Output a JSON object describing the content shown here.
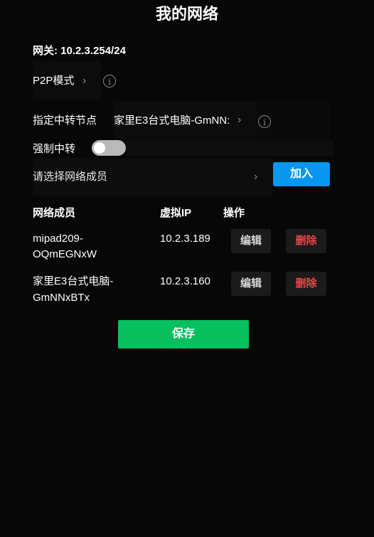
{
  "page": {
    "title": "我的网络"
  },
  "gateway": {
    "text": "网关: 10.2.3.254/24"
  },
  "p2p": {
    "label": "P2P模式",
    "chevron": "›",
    "info_icon": "i"
  },
  "relay": {
    "label": "指定中转节点",
    "value": "家里E3台式电脑-GmNN:",
    "chevron": "›",
    "info_icon": "i"
  },
  "force_relay": {
    "label": "强制中转",
    "enabled": false
  },
  "member_select": {
    "placeholder": "请选择网络成员",
    "chevron": "›",
    "join_label": "加入"
  },
  "table": {
    "headers": {
      "member": "网络成员",
      "ip": "虚拟IP",
      "action": "操作"
    },
    "rows": [
      {
        "name_line1": "mipad209-",
        "name_line2": "OQmEGNxW",
        "ip": "10.2.3.189",
        "edit": "编辑",
        "delete": "删除"
      },
      {
        "name_line1": "家里E3台式电脑-",
        "name_line2": "GmNNxBTx",
        "ip": "10.2.3.160",
        "edit": "编辑",
        "delete": "删除"
      }
    ]
  },
  "save": {
    "label": "保存"
  },
  "colors": {
    "accent_blue": "#0797f0",
    "save_green": "#06bf5d",
    "delete_red": "#ea4848",
    "background": "#070707"
  }
}
